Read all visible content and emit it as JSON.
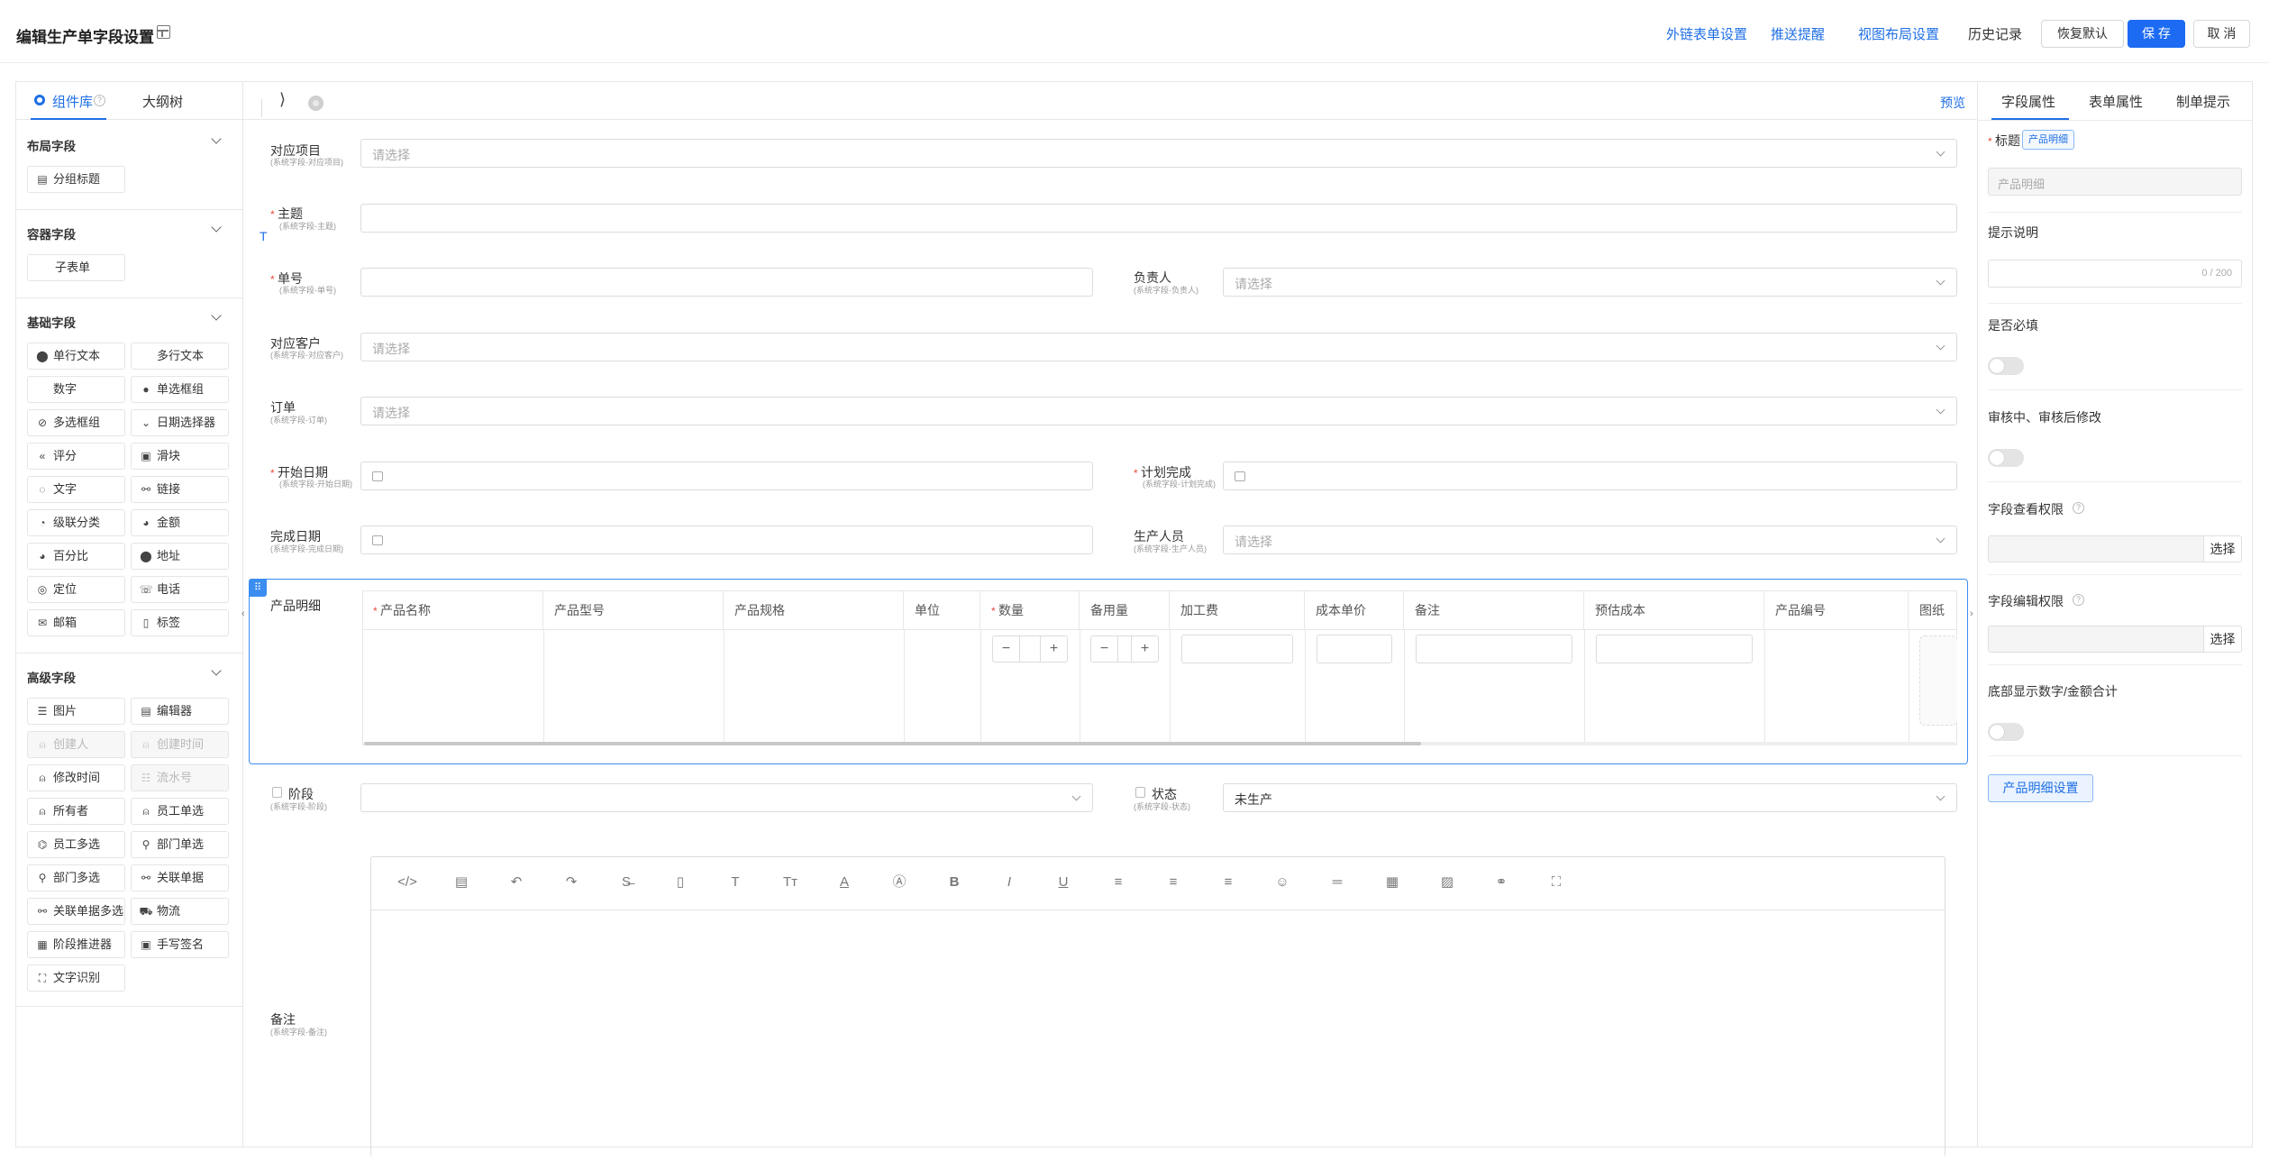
{
  "header": {
    "title": "编辑生产单字段设置",
    "links": [
      "外链表单设置",
      "推送提醒",
      "视图布局设置",
      "历史记录"
    ],
    "restore_label": "恢复默认",
    "save_label": "保 存",
    "cancel_label": "取 消"
  },
  "left_panel": {
    "tabs": [
      "组件库",
      "大纲树"
    ],
    "sections": {
      "layout": {
        "title": "布局字段",
        "items": [
          {
            "label": "分组标题",
            "icon": "group-title-icon"
          }
        ]
      },
      "container": {
        "title": "容器字段",
        "items": [
          {
            "label": "子表单",
            "icon": "none"
          }
        ]
      },
      "basic": {
        "title": "基础字段",
        "items": [
          {
            "label": "单行文本",
            "icon": "single-text-icon"
          },
          {
            "label": "多行文本",
            "icon": "none"
          },
          {
            "label": "数字",
            "icon": "none"
          },
          {
            "label": "单选框组",
            "icon": "radio-icon"
          },
          {
            "label": "多选框组",
            "icon": "checkbox-icon"
          },
          {
            "label": "日期选择器",
            "icon": "chevron-down-icon"
          },
          {
            "label": "评分",
            "icon": "double-chevron-left-icon"
          },
          {
            "label": "滑块",
            "icon": "slider-icon"
          },
          {
            "label": "文字",
            "icon": "text-icon"
          },
          {
            "label": "链接",
            "icon": "link-icon"
          },
          {
            "label": "级联分类",
            "icon": "cascade-icon"
          },
          {
            "label": "金额",
            "icon": "amount-icon"
          },
          {
            "label": "百分比",
            "icon": "percent-icon"
          },
          {
            "label": "地址",
            "icon": "map-pin-icon"
          },
          {
            "label": "定位",
            "icon": "location-icon"
          },
          {
            "label": "电话",
            "icon": "phone-icon"
          },
          {
            "label": "邮箱",
            "icon": "mail-icon"
          },
          {
            "label": "标签",
            "icon": "tag-icon"
          }
        ]
      },
      "advanced": {
        "title": "高级字段",
        "items": [
          {
            "label": "图片",
            "icon": "image-icon"
          },
          {
            "label": "编辑器",
            "icon": "editor-icon"
          },
          {
            "label": "创建人",
            "icon": "user-icon",
            "disabled": true
          },
          {
            "label": "创建时间",
            "icon": "user-icon",
            "disabled": true
          },
          {
            "label": "修改时间",
            "icon": "user-icon"
          },
          {
            "label": "流水号",
            "icon": "serial-icon",
            "disabled": true
          },
          {
            "label": "所有者",
            "icon": "user-icon"
          },
          {
            "label": "员工单选",
            "icon": "user-icon"
          },
          {
            "label": "员工多选",
            "icon": "users-icon"
          },
          {
            "label": "部门单选",
            "icon": "org-icon"
          },
          {
            "label": "部门多选",
            "icon": "org-icon"
          },
          {
            "label": "关联单据",
            "icon": "link-icon"
          },
          {
            "label": "关联单据多选",
            "icon": "link-icon"
          },
          {
            "label": "物流",
            "icon": "truck-icon"
          },
          {
            "label": "阶段推进器",
            "icon": "stage-icon"
          },
          {
            "label": "手写签名",
            "icon": "signature-icon"
          },
          {
            "label": "文字识别",
            "icon": "scan-icon"
          }
        ]
      }
    }
  },
  "canvas": {
    "preview_label": "预览",
    "fields": {
      "project": {
        "label": "对应项目",
        "sub": "(系统字段-对应项目)",
        "placeholder": "请选择"
      },
      "subject": {
        "label": "主题",
        "sub": "(系统字段-主题)"
      },
      "number": {
        "label": "单号",
        "sub": "(系统字段-单号)"
      },
      "owner": {
        "label": "负责人",
        "sub": "(系统字段-负责人)",
        "placeholder": "请选择"
      },
      "customer": {
        "label": "对应客户",
        "sub": "(系统字段-对应客户)",
        "placeholder": "请选择"
      },
      "order": {
        "label": "订单",
        "sub": "(系统字段-订单)",
        "placeholder": "请选择"
      },
      "start_date": {
        "label": "开始日期",
        "sub": "(系统字段-开始日期)"
      },
      "plan_done": {
        "label": "计划完成",
        "sub": "(系统字段-计划完成)"
      },
      "done_date": {
        "label": "完成日期",
        "sub": "(系统字段-完成日期)"
      },
      "producer": {
        "label": "生产人员",
        "sub": "(系统字段-生产人员)",
        "placeholder": "请选择"
      },
      "stage": {
        "label": "阶段",
        "sub": "(系统字段-阶段)"
      },
      "status": {
        "label": "状态",
        "sub": "(系统字段-状态)",
        "value": "未生产"
      },
      "remark": {
        "label": "备注",
        "sub": "(系统字段-备注)"
      }
    },
    "product_table": {
      "label": "产品明细",
      "columns": [
        "产品名称",
        "产品型号",
        "产品规格",
        "单位",
        "数量",
        "备用量",
        "加工费",
        "成本单价",
        "备注",
        "预估成本",
        "产品编号",
        "图纸"
      ]
    },
    "editor_tools": [
      "code-icon",
      "template-icon",
      "undo-icon",
      "redo-icon",
      "strikethrough-icon",
      "document-icon",
      "font-size-icon",
      "text-height-icon",
      "font-color-icon",
      "background-color-icon",
      "bold-icon",
      "italic-icon",
      "underline-icon",
      "align-left-icon",
      "align-center-icon",
      "align-right-icon",
      "emoji-icon",
      "horizontal-rule-icon",
      "table-icon",
      "image-icon",
      "attachment-icon",
      "fullscreen-icon"
    ]
  },
  "right_panel": {
    "tabs": [
      "字段属性",
      "表单属性",
      "制单提示"
    ],
    "title_label": "标题",
    "title_tag": "产品明细",
    "title_input": "产品明细",
    "hint_label": "提示说明",
    "hint_counter": "0 / 200",
    "required_label": "是否必填",
    "audit_label": "审核中、审核后修改",
    "view_perm_label": "字段查看权限",
    "edit_perm_label": "字段编辑权限",
    "select_label": "选择",
    "bottom_sum_label": "底部显示数字/金额合计",
    "settings_button": "产品明细设置"
  }
}
